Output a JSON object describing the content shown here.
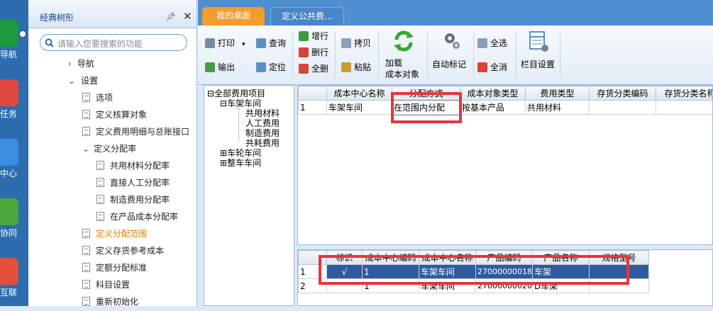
{
  "left_nav": {
    "items": [
      {
        "label": "务导航",
        "icon": "grid-icon",
        "color": "#1d9a3d"
      },
      {
        "label": "里任务",
        "icon": "checklist-icon",
        "color": "#e0483d"
      },
      {
        "label": "表中心",
        "icon": "report-icon",
        "color": "#3a8de0"
      },
      {
        "label": "队协同",
        "icon": "compass-icon",
        "color": "#4aa83a"
      },
      {
        "label": "业互联",
        "icon": "network-icon",
        "color": "#e24f3b"
      }
    ]
  },
  "sidebar": {
    "title": "经典树形",
    "search_placeholder": "请输入您要搜索的功能",
    "items": [
      {
        "label": "导航",
        "type": "collapsed"
      },
      {
        "label": "设置",
        "type": "expanded"
      },
      {
        "label": "选项",
        "type": "doc"
      },
      {
        "label": "定义核算对象",
        "type": "doc"
      },
      {
        "label": "定义费用明细与总账接口",
        "type": "doc"
      },
      {
        "label": "定义分配率",
        "type": "expanded"
      },
      {
        "label": "共用材料分配率",
        "type": "doc"
      },
      {
        "label": "直接人工分配率",
        "type": "doc"
      },
      {
        "label": "制造费用分配率",
        "type": "doc"
      },
      {
        "label": "在产品成本分配率",
        "type": "doc"
      },
      {
        "label": "定义分配范围",
        "type": "doc",
        "selected": true
      },
      {
        "label": "定义存货参考成本",
        "type": "doc"
      },
      {
        "label": "定额分配标准",
        "type": "doc"
      },
      {
        "label": "科目设置",
        "type": "doc"
      },
      {
        "label": "重新初始化",
        "type": "doc"
      }
    ]
  },
  "tabs": [
    {
      "label": "我的桌面"
    },
    {
      "label": "定义公共费…"
    }
  ],
  "toolbar": {
    "print": "打印",
    "export": "输出",
    "query": "查询",
    "locate": "定位",
    "add_row": "增行",
    "delete_row": "删行",
    "delete_all": "全删",
    "copy": "拷贝",
    "paste": "粘贴",
    "load_line1": "加载",
    "load_line2": "成本对象",
    "auto_mark": "自动标记",
    "select_all": "全选",
    "deselect_all": "全消",
    "column_settings": "栏目设置"
  },
  "expense_tree": {
    "root": "全部费用项目",
    "workshop1": "车架车间",
    "children": [
      "共用材料",
      "人工费用",
      "制造费用",
      "共耗费用"
    ],
    "workshop2": "车轮车间",
    "workshop3": "整车车间"
  },
  "top_grid": {
    "columns": [
      "成本中心名称",
      "分配方式",
      "成本对象类型",
      "费用类型",
      "存货分类编码",
      "存货分类名称"
    ],
    "rows": [
      {
        "num": "1",
        "cells": [
          "车架车间",
          "在范围内分配",
          "按基本产品",
          "共用材料",
          "",
          ""
        ]
      }
    ]
  },
  "bottom_grid": {
    "columns": [
      "标识",
      "成本中心编码",
      "成本中心名称",
      "产品编码",
      "产品名称",
      "规格型号"
    ],
    "rows": [
      {
        "num": "1",
        "cells": [
          "√",
          "1",
          "车架车间",
          "27000000018",
          "车架",
          ""
        ]
      },
      {
        "num": "2",
        "cells": [
          "",
          "1",
          "车架车间",
          "27000000020",
          "D车架",
          ""
        ]
      }
    ]
  }
}
